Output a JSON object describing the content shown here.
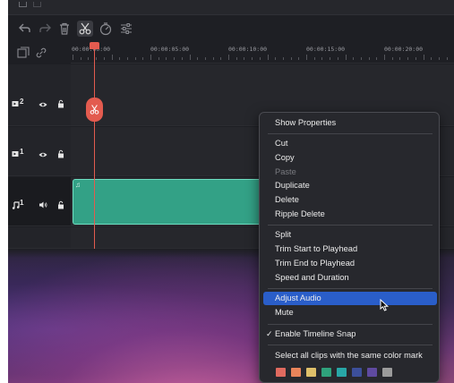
{
  "ruler": {
    "labels": [
      "00:00:00:00",
      "00:00:05:00",
      "00:00:10:00",
      "00:00:15:00",
      "00:00:20:00"
    ]
  },
  "tracks": [
    {
      "label": "2",
      "kind": "video"
    },
    {
      "label": "1",
      "kind": "video"
    },
    {
      "label": "1",
      "kind": "audio"
    }
  ],
  "clip": {
    "label": "♫"
  },
  "menu": {
    "items": [
      {
        "label": "Show Properties"
      },
      {
        "label": "Cut"
      },
      {
        "label": "Copy"
      },
      {
        "label": "Paste",
        "disabled": true
      },
      {
        "label": "Duplicate"
      },
      {
        "label": "Delete"
      },
      {
        "label": "Ripple Delete"
      },
      {
        "label": "Split"
      },
      {
        "label": "Trim Start to Playhead"
      },
      {
        "label": "Trim End to Playhead"
      },
      {
        "label": "Speed and Duration"
      },
      {
        "label": "Adjust Audio",
        "highlighted": true
      },
      {
        "label": "Mute"
      },
      {
        "label": "Enable Timeline Snap",
        "checked": true,
        "check_mark": "✓"
      },
      {
        "label": "Select all clips with the same color mark"
      }
    ],
    "color_marks": [
      "#e06a5f",
      "#e9845a",
      "#dfc06a",
      "#2fa27c",
      "#28a7a7",
      "#3c4f9a",
      "#5f4aa0",
      "#9b9b9b"
    ]
  },
  "colors": {
    "accent": "#2a5ec9",
    "playhead": "#e35b4f",
    "audio_clip": "#33a186"
  },
  "icons": {
    "toolbar": [
      "undo-icon",
      "redo-icon",
      "trash-icon",
      "scissors-icon",
      "speed-icon",
      "adjust-icon"
    ],
    "ruler_left": [
      "add-track-icon",
      "link-icon"
    ]
  }
}
